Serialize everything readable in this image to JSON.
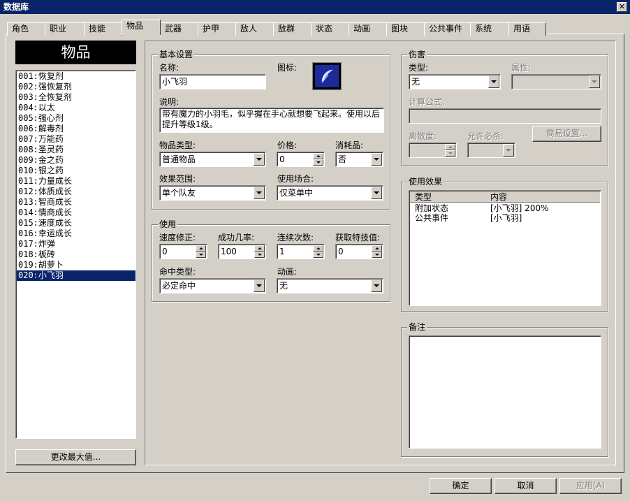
{
  "window": {
    "title": "数据库",
    "close_glyph": "✕"
  },
  "tabs": [
    {
      "label": "角色",
      "active": false
    },
    {
      "label": "职业",
      "active": false
    },
    {
      "label": "技能",
      "active": false
    },
    {
      "label": "物品",
      "active": true
    },
    {
      "label": "武器",
      "active": false
    },
    {
      "label": "护甲",
      "active": false
    },
    {
      "label": "敌人",
      "active": false
    },
    {
      "label": "敌群",
      "active": false
    },
    {
      "label": "状态",
      "active": false
    },
    {
      "label": "动画",
      "active": false
    },
    {
      "label": "图块",
      "active": false
    },
    {
      "label": "公共事件",
      "active": false
    },
    {
      "label": "系统",
      "active": false
    },
    {
      "label": "用语",
      "active": false
    }
  ],
  "left_panel": {
    "header": "物品",
    "items": [
      "001:恢复剂",
      "002:强恢复剂",
      "003:全恢复剂",
      "004:以太",
      "005:强心剂",
      "006:解毒剂",
      "007:万能药",
      "008:圣灵药",
      "009:金之药",
      "010:银之药",
      "011:力量成长",
      "012:体质成长",
      "013:智商成长",
      "014:情商成长",
      "015:速度成长",
      "016:幸运成长",
      "017:炸弹",
      "018:板砖",
      "019:胡萝卜",
      "020:小飞羽"
    ],
    "selected_index": 19,
    "change_max_button": "更改最大值..."
  },
  "basic": {
    "legend": "基本设置",
    "name_label": "名称:",
    "name_value": "小飞羽",
    "icon_label": "图标:",
    "icon_name": "feather-icon",
    "desc_label": "说明:",
    "desc_value": "带有魔力的小羽毛，似乎握在手心就想要飞起来。使用以后提升等级1级。",
    "item_type_label": "物品类型:",
    "item_type_value": "普通物品",
    "price_label": "价格:",
    "price_value": "0",
    "consumable_label": "消耗品:",
    "consumable_value": "否",
    "scope_label": "效果范围:",
    "scope_value": "单个队友",
    "occasion_label": "使用场合:",
    "occasion_value": "仅菜单中"
  },
  "invocation": {
    "legend": "使用",
    "speed_label": "速度修正:",
    "speed_value": "0",
    "success_label": "成功几率:",
    "success_value": "100",
    "repeat_label": "连续次数:",
    "repeat_value": "1",
    "tp_label": "获取特技值:",
    "tp_value": "0",
    "hit_type_label": "命中类型:",
    "hit_type_value": "必定命中",
    "animation_label": "动画:",
    "animation_value": "无"
  },
  "damage": {
    "legend": "伤害",
    "type_label": "类型:",
    "type_value": "无",
    "element_label": "属性:",
    "element_value": "",
    "formula_label": "计算公式:",
    "formula_value": "",
    "variance_label": "离散度:",
    "variance_value": "",
    "critical_label": "允许必杀:",
    "critical_value": "",
    "simple_button": "简易设置..."
  },
  "effects": {
    "legend": "使用效果",
    "col_type": "类型",
    "col_content": "内容",
    "rows": [
      {
        "type": "附加状态",
        "content": "[小飞羽] 200%"
      },
      {
        "type": "公共事件",
        "content": "[小飞羽]"
      }
    ]
  },
  "note": {
    "legend": "备注",
    "value": ""
  },
  "footer": {
    "ok": "确定",
    "cancel": "取消",
    "apply": "应用(A)"
  }
}
